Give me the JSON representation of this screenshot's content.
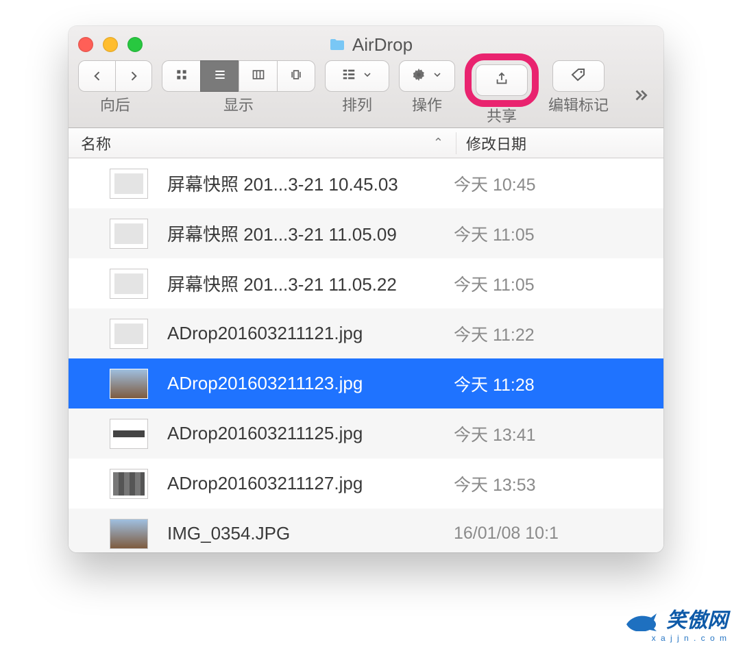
{
  "window": {
    "title": "AirDrop"
  },
  "toolbar": {
    "nav_label": "向后",
    "view_label": "显示",
    "arrange_label": "排列",
    "action_label": "操作",
    "share_label": "共享",
    "tags_label": "编辑标记"
  },
  "columns": {
    "name": "名称",
    "modified": "修改日期"
  },
  "files": [
    {
      "name": "屏幕快照 201...3-21 10.45.03",
      "date": "今天 10:45",
      "thumb": "doc",
      "selected": false
    },
    {
      "name": "屏幕快照 201...3-21 11.05.09",
      "date": "今天 11:05",
      "thumb": "doc",
      "selected": false
    },
    {
      "name": "屏幕快照 201...3-21 11.05.22",
      "date": "今天 11:05",
      "thumb": "doc",
      "selected": false
    },
    {
      "name": "ADrop201603211121.jpg",
      "date": "今天 11:22",
      "thumb": "doc",
      "selected": false
    },
    {
      "name": "ADrop201603211123.jpg",
      "date": "今天 11:28",
      "thumb": "photo",
      "selected": true
    },
    {
      "name": "ADrop201603211125.jpg",
      "date": "今天 13:41",
      "thumb": "strip",
      "selected": false
    },
    {
      "name": "ADrop201603211127.jpg",
      "date": "今天 13:53",
      "thumb": "apps",
      "selected": false
    },
    {
      "name": "IMG_0354.JPG",
      "date": "16/01/08 10:1",
      "thumb": "photo",
      "selected": false
    }
  ],
  "watermark": {
    "line1": "笑傲网",
    "line2": "x a j j n . c o m"
  },
  "highlight_color": "#e9236f"
}
